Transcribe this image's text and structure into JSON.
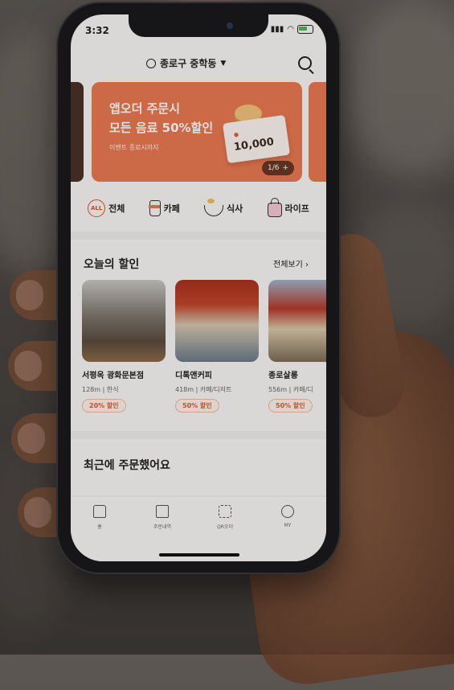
{
  "status_bar": {
    "time": "3:32"
  },
  "header": {
    "location": "종로구 중학동"
  },
  "banner": {
    "line1": "앱오더 주문시",
    "line2": "모든 음료 50%할인",
    "subtitle": "이벤트 종료시까지",
    "coupon_value": "10,000",
    "pager": "1/6"
  },
  "categories": [
    {
      "label": "전체",
      "icon": "all-icon"
    },
    {
      "label": "카페",
      "icon": "coffee-cup-icon"
    },
    {
      "label": "식사",
      "icon": "bowl-icon"
    },
    {
      "label": "라이프",
      "icon": "shopping-bag-icon"
    }
  ],
  "today_deals": {
    "title": "오늘의 할인",
    "see_all": "전체보기",
    "items": [
      {
        "name": "서평옥 광화문본점",
        "meta": "128m | 한식",
        "badge": "20% 할인"
      },
      {
        "name": "디톡앤커피",
        "meta": "418m | 카페/디저트",
        "badge": "50% 할인"
      },
      {
        "name": "종로살롱",
        "meta": "556m | 카페/디",
        "badge": "50% 할인"
      }
    ]
  },
  "recent_orders": {
    "title": "최근에 주문했어요"
  },
  "tabbar": [
    {
      "label": "홈",
      "icon": "home-icon"
    },
    {
      "label": "주문내역",
      "icon": "receipt-icon"
    },
    {
      "label": "QR오더",
      "icon": "qr-code-icon"
    },
    {
      "label": "MY",
      "icon": "profile-icon"
    }
  ],
  "colors": {
    "accent": "#e97850",
    "badge_text": "#e05a2e",
    "all_icon": "#e04f2a"
  }
}
